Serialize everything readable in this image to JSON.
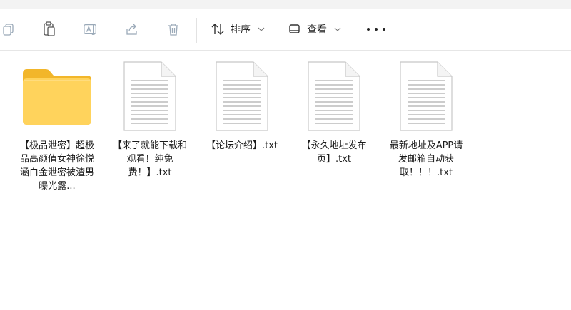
{
  "toolbar": {
    "copy_icon": "copy-icon",
    "paste_icon": "paste-icon",
    "rename_icon": "rename-icon",
    "share_icon": "share-icon",
    "delete_icon": "delete-icon",
    "sort_label": "排序",
    "view_label": "查看",
    "more_icon": "more-icon"
  },
  "files": [
    {
      "type": "folder",
      "name": "【极品泄密】超极品高颜值女神徐悦涵白金泄密被渣男曝光露..."
    },
    {
      "type": "txt",
      "name": "【来了就能下载和观看！纯免费！】.txt"
    },
    {
      "type": "txt",
      "name": "【论坛介绍】.txt"
    },
    {
      "type": "txt",
      "name": "【永久地址发布页】.txt"
    },
    {
      "type": "txt",
      "name": "最新地址及APP请发邮箱自动获取！！！.txt"
    }
  ],
  "colors": {
    "folder_back": "#f2b62a",
    "folder_front": "#ffd35c",
    "doc_fill": "#ffffff",
    "doc_stroke": "#c8c8c8",
    "doc_lines": "#9a9a9a"
  }
}
